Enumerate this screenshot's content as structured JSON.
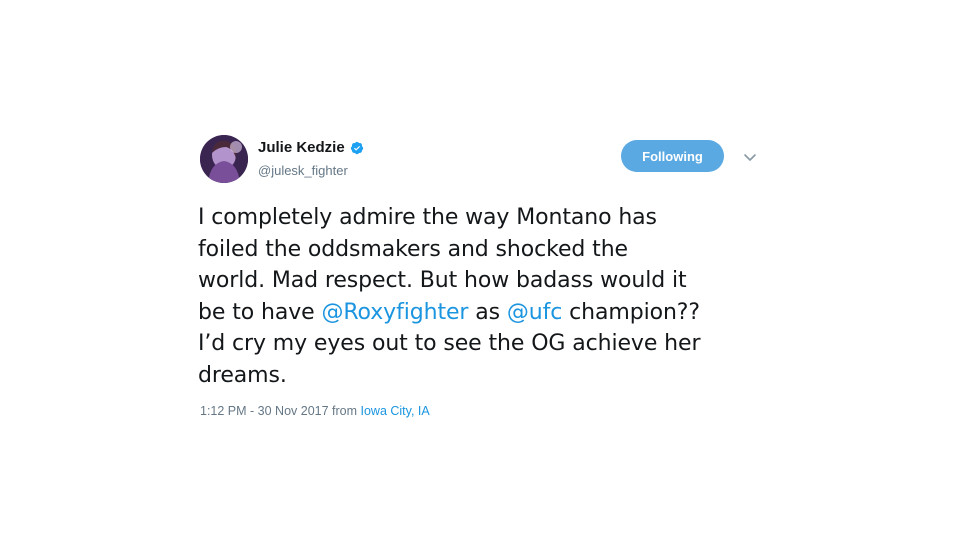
{
  "user": {
    "display_name": "Julie Kedzie",
    "handle": "@julesk_fighter",
    "verified": true,
    "avatar_icon": "profile-avatar"
  },
  "follow_button": {
    "label": "Following",
    "color": "#5aa9e2"
  },
  "menu": {
    "icon": "chevron-down-icon"
  },
  "tweet": {
    "line1": "I completely admire the way Montano has",
    "line2": "foiled the oddsmakers and shocked the",
    "line3": "world. Mad respect. But how badass would it",
    "line4_pre": "be to have ",
    "mention1": "@Roxyfighter",
    "line4_mid": " as ",
    "mention2": "@ufc",
    "line4_post": " champion??",
    "line5": "I’d cry my eyes out to see the OG achieve her",
    "line6": "dreams."
  },
  "meta": {
    "time": "1:12 PM - 30 Nov 2017",
    "from": " from ",
    "place": "Iowa City, IA"
  },
  "colors": {
    "link": "#1b95e0",
    "secondary_text": "#657786",
    "verified": "#1da1f2"
  }
}
